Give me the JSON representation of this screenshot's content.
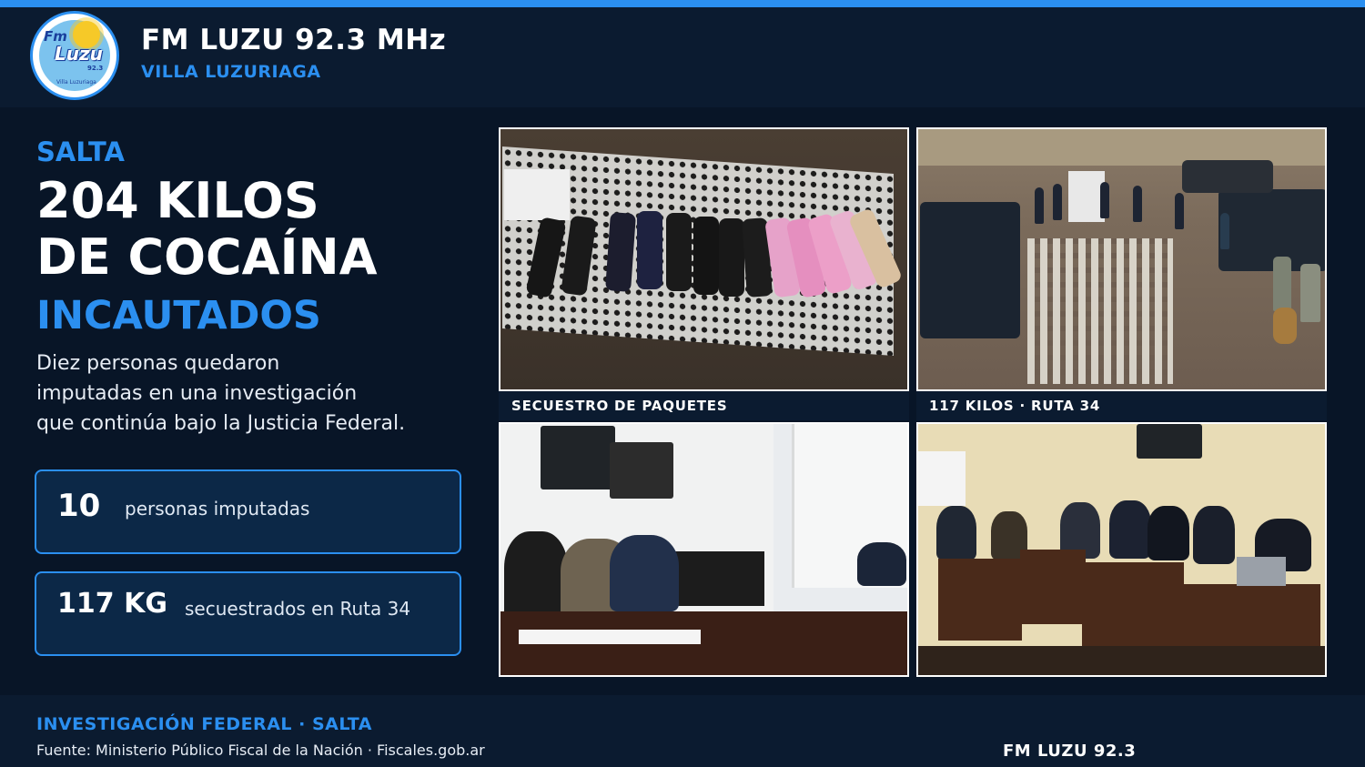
{
  "header": {
    "station": "FM LUZU 92.3 MHz",
    "locality": "VILLA LUZURIAGA",
    "logo_text": {
      "fm": "Fm",
      "luzu": "Luzu",
      "number": "92.3",
      "place": "Villa Luzuriaga"
    }
  },
  "story": {
    "kicker": "SALTA",
    "headline_line1": "204 KILOS",
    "headline_line2": "DE COCAÍNA",
    "headline_accent": "INCAUTADOS",
    "description_lines": [
      "Diez personas quedaron",
      "imputadas en una investigación",
      "que continúa bajo la Justicia Federal."
    ]
  },
  "stats": [
    {
      "value": "10",
      "label": "personas imputadas"
    },
    {
      "value": "117 KG",
      "label": "secuestrados en Ruta 34"
    }
  ],
  "photos": [
    {
      "caption": "SECUESTRO DE PAQUETES"
    },
    {
      "caption": "117 KILOS · RUTA 34"
    }
  ],
  "footer": {
    "title": "INVESTIGACIÓN FEDERAL · SALTA",
    "source": "Fuente: Ministerio Público Fiscal de la Nación · Fiscales.gob.ar",
    "brand": "FM LUZU 92.3"
  },
  "colors": {
    "background": "#081527",
    "panel": "#0b1b30",
    "accent": "#2b8ff0",
    "stat_box": "#0c2847"
  }
}
